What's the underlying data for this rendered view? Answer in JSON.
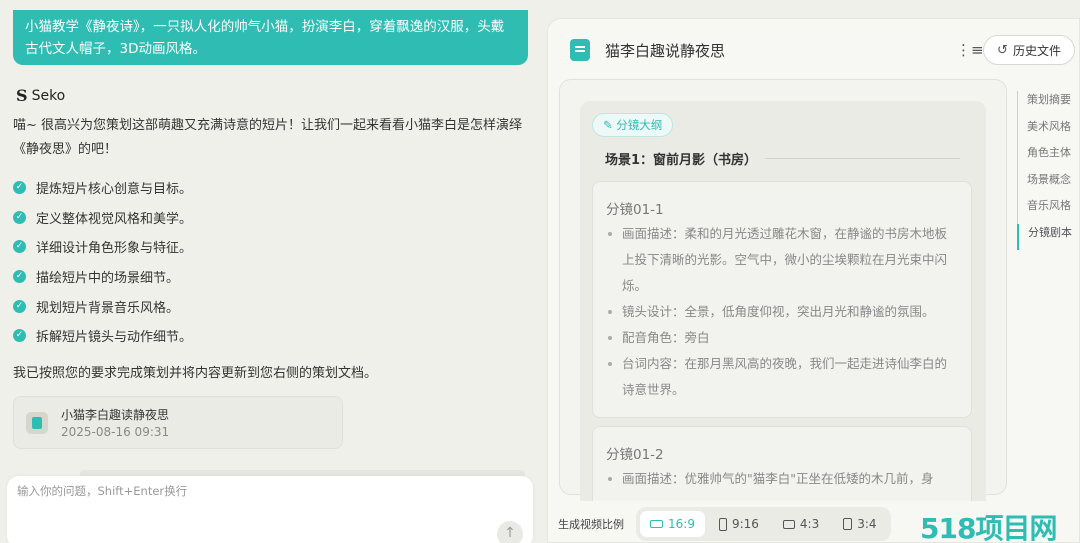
{
  "chat": {
    "user_message": "小猫教学《静夜诗》，一只拟人化的帅气小猫，扮演李白，穿着飘逸的汉服，头戴古代文人帽子，3D动画风格。",
    "assistant_name": "Seko",
    "intro": "喵~ 很高兴为您策划这部萌趣又充满诗意的短片！让我们一起来看看小猫李白是怎样演绎《静夜思》的吧！",
    "checklist": [
      "提炼短片核心创意与目标。",
      "定义整体视觉风格和美学。",
      "详细设计角色形象与特征。",
      "描绘短片中的场景细节。",
      "规划短片背景音乐风格。",
      "拆解短片镜头与动作细节。"
    ],
    "done_text": "我已按照您的要求完成策划并将内容更新到您右侧的策划文档。",
    "doc_card": {
      "title": "小猫李白趣读静夜思",
      "date": "2025-08-16 09:31"
    },
    "input_placeholder": "输入你的问题，Shift+Enter换行"
  },
  "doc": {
    "title": "猫李白趣说静夜思",
    "history_label": "历史文件",
    "tag": "分镜大纲",
    "scene_title": "场景1：窗前月影（书房）",
    "shots": [
      {
        "title": "分镜01-1",
        "items": [
          "画面描述：柔和的月光透过雕花木窗，在静谧的书房木地板上投下清晰的光影。空气中，微小的尘埃颗粒在月光束中闪烁。",
          "镜头设计：全景，低角度仰视，突出月光和静谧的氛围。",
          "配音角色：旁白",
          "台词内容：在那月黑风高的夜晚，我们一起走进诗仙李白的诗意世界。"
        ]
      },
      {
        "title": "分镜01-2",
        "items": [
          "画面描述：优雅帅气的\"猫李白\"正坐在低矮的木几前，身"
        ]
      }
    ],
    "nav": [
      "策划摘要",
      "美术风格",
      "角色主体",
      "场景概念",
      "音乐风格",
      "分镜剧本"
    ],
    "active_nav": "分镜剧本",
    "ratio_label": "生成视频比例",
    "ratios": [
      "16:9",
      "9:16",
      "4:3",
      "3:4"
    ],
    "selected_ratio": "16:9"
  },
  "watermark": "518项目网",
  "colors": {
    "accent": "#2fbcb3",
    "background": "#f0f0eb"
  },
  "icons": [
    "check-icon",
    "document-icon",
    "send-arrow-icon",
    "outline-toggle-icon",
    "history-clock-icon",
    "edit-icon",
    "ratio-landscape-icon",
    "ratio-portrait-icon"
  ]
}
